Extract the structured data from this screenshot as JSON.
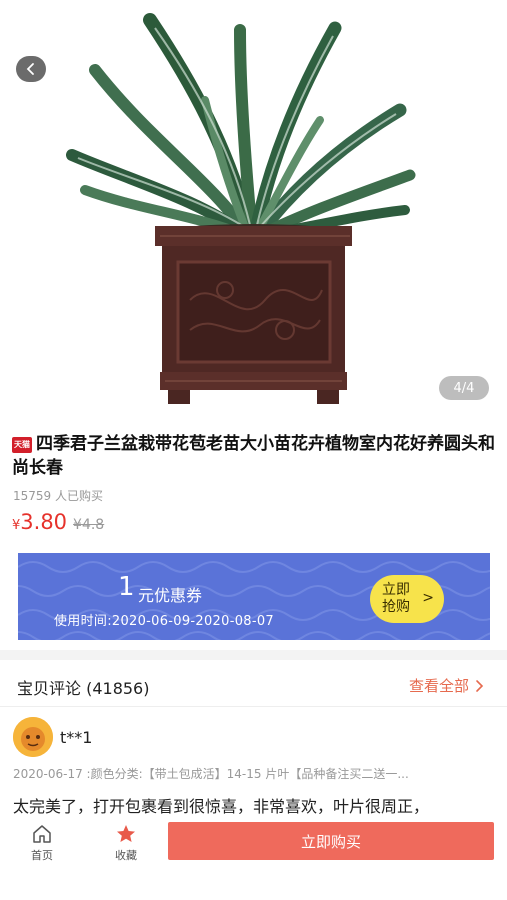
{
  "gallery": {
    "counter": "4/4"
  },
  "product": {
    "badge": "天猫",
    "title": "四季君子兰盆栽带花苞老苗大小苗花卉植物室内花好养圆头和尚长春",
    "sold": "15759 人已购买",
    "currency": "¥",
    "price": "3.80",
    "original_price": "¥4.8"
  },
  "coupon": {
    "amount": "1",
    "unit": "元优惠券",
    "date": "使用时间:2020-06-09-2020-08-07",
    "button_line1": "立即",
    "button_line2": "抢购",
    "button_arrow": ">"
  },
  "reviews": {
    "title": "宝贝评论 (41856)",
    "view_all": "查看全部",
    "item": {
      "user": "t**1",
      "meta": "2020-06-17 :颜色分类:【带土包成活】14-15 片叶【品种备注买二送一...",
      "text": "太完美了，打开包裹看到很惊喜，非常喜欢，叶片很周正，"
    }
  },
  "bottom_bar": {
    "home_label": "首页",
    "favorite_label": "收藏",
    "buy_label": "立即购买"
  },
  "colors": {
    "price": "#e6322b",
    "coupon_bg": "#5a73d8",
    "coupon_button": "#f7e34b",
    "buy_button": "#ef6a5c",
    "link": "#e66a4e",
    "favorite_star": "#e85a4a"
  },
  "icons": {
    "back": "chevron-left-icon",
    "home": "home-icon",
    "favorite": "star-icon",
    "view_all": "chevron-right-icon"
  }
}
